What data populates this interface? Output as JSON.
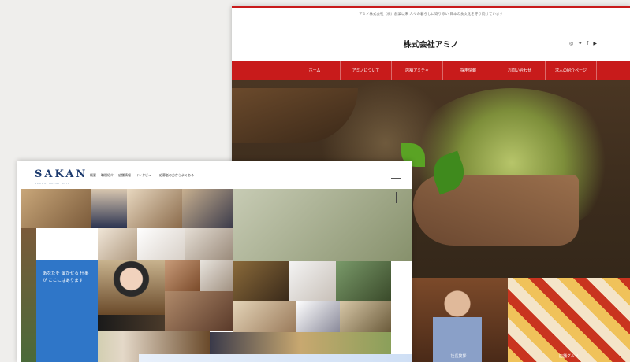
{
  "back_site": {
    "notice": "アミノ株式会社（株）創業以来 人々の暮らしに寄り添い 日本の食文化を守り続けています",
    "logo": "株式会社アミノ",
    "social_icons": [
      "instagram-icon",
      "twitter-icon",
      "facebook-icon",
      "youtube-icon"
    ],
    "social_labels": [
      "◎",
      "✦",
      "f",
      "▶"
    ],
    "nav": [
      "ホーム",
      "アミノについて",
      "店舗アミチャ",
      "採用情報",
      "お問い合わせ",
      "求人の紹介ページ"
    ],
    "thumb_left_caption": "社長挨拶",
    "thumb_right_caption": "店舗グルメ",
    "accent": "#c81b1b"
  },
  "front_site": {
    "brand": "SAKAN",
    "brand_sub": "RECRUITMENT SITE",
    "nav": [
      "概要",
      "職種紹介",
      "店舗情報",
      "インタビュー",
      "応募者の方からよくある"
    ],
    "tagline": "あなたを 御かせる 仕事が ここにはあります",
    "accent": "#2f76c8"
  }
}
